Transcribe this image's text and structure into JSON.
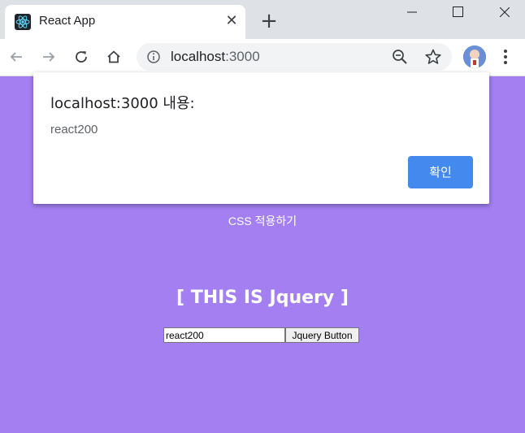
{
  "browser": {
    "tab_title": "React App",
    "tab_close": "✕",
    "new_tab": "+",
    "url_host": "localhost",
    "url_port": ":3000",
    "icons": {
      "back": "arrow-left-icon",
      "forward": "arrow-right-icon",
      "reload": "reload-icon",
      "home": "home-icon",
      "info": "info-icon",
      "zoom": "zoom-out-icon",
      "star": "star-icon",
      "menu": "more-vert-icon"
    }
  },
  "dialog": {
    "title": "localhost:3000 내용:",
    "message": "react200",
    "ok_label": "확인",
    "ok_color": "#448aee"
  },
  "page": {
    "background": "#a37ff2",
    "css_label": "CSS 적용하기",
    "jquery_title": "[ THIS IS Jquery ]",
    "input_value": "react200",
    "button_label": "Jquery Button"
  }
}
